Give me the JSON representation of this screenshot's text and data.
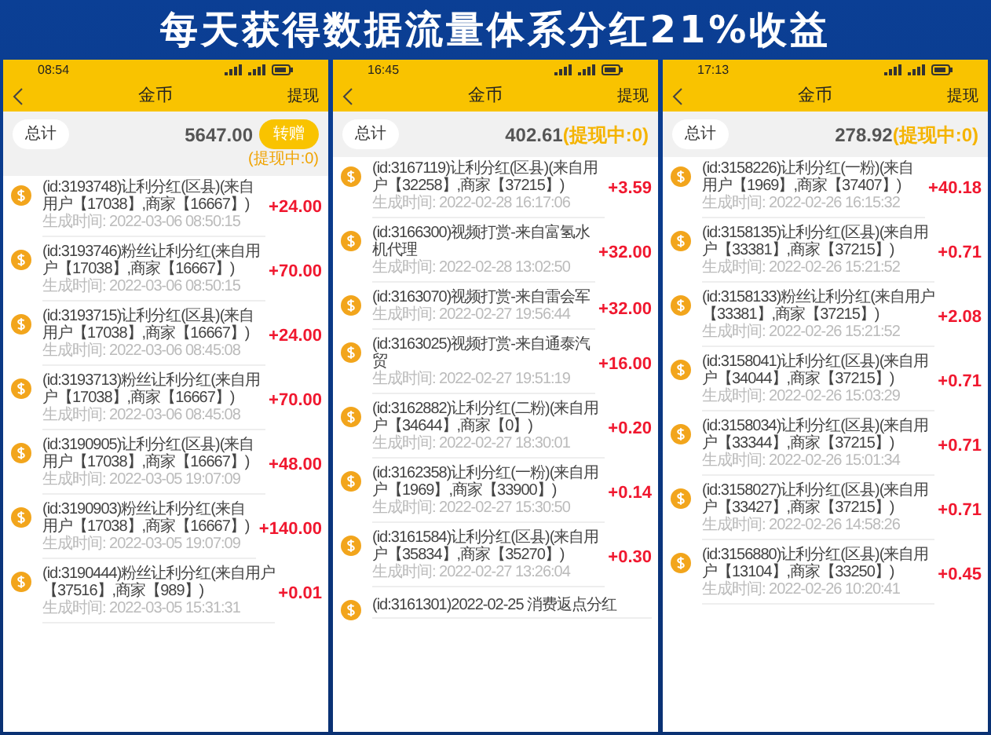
{
  "headline": "每天获得数据流量体系分红21%收益",
  "phones": [
    {
      "kind": "with_transfer",
      "status_time": "08:54",
      "title": "金币",
      "action": "提现",
      "total_label": "总计",
      "total": "5647.00",
      "transfer_button": "转赠",
      "pending": "(提现中:0)",
      "records": [
        {
          "description": "(id:3193748)让利分红(区县)(来自用户【17038】,商家【16667】)",
          "time": "生成时间: 2022-03-06 08:50:15",
          "amount": "+24.00"
        },
        {
          "description": "(id:3193746)粉丝让利分红(来自用户【17038】,商家【16667】)",
          "time": "生成时间: 2022-03-06 08:50:15",
          "amount": "+70.00"
        },
        {
          "description": "(id:3193715)让利分红(区县)(来自用户【17038】,商家【16667】)",
          "time": "生成时间: 2022-03-06 08:45:08",
          "amount": "+24.00"
        },
        {
          "description": "(id:3193713)粉丝让利分红(来自用户【17038】,商家【16667】)",
          "time": "生成时间: 2022-03-06 08:45:08",
          "amount": "+70.00"
        },
        {
          "description": "(id:3190905)让利分红(区县)(来自用户【17038】,商家【16667】)",
          "time": "生成时间: 2022-03-05 19:07:09",
          "amount": "+48.00"
        },
        {
          "description": "(id:3190903)粉丝让利分红(来自用户【17038】,商家【16667】)",
          "time": "生成时间: 2022-03-05 19:07:09",
          "amount": "+140.00"
        },
        {
          "description": "(id:3190444)粉丝让利分红(来自用户【37516】,商家【989】)",
          "time": "生成时间: 2022-03-05 15:31:31",
          "amount": "+0.01"
        }
      ]
    },
    {
      "kind": "plain",
      "status_time": "16:45",
      "title": "金币",
      "action": "提现",
      "total_label": "总计",
      "total": "402.61",
      "pending": "(提现中:0)",
      "records": [
        {
          "description": "(id:3167119)让利分红(区县)(来自用户【32258】,商家【37215】)",
          "time": "生成时间: 2022-02-28 16:17:06",
          "amount": "+3.59"
        },
        {
          "description": "(id:3166300)视频打赏-来自富氢水机代理",
          "time": "生成时间: 2022-02-28 13:02:50",
          "amount": "+32.00"
        },
        {
          "description": "(id:3163070)视频打赏-来自雷会军",
          "time": "生成时间: 2022-02-27 19:56:44",
          "amount": "+32.00"
        },
        {
          "description": "(id:3163025)视频打赏-来自通泰汽贸",
          "time": "生成时间: 2022-02-27 19:51:19",
          "amount": "+16.00"
        },
        {
          "description": "(id:3162882)让利分红(二粉)(来自用户【34644】,商家【0】)",
          "time": "生成时间: 2022-02-27 18:30:01",
          "amount": "+0.20"
        },
        {
          "description": "(id:3162358)让利分红(一粉)(来自用户【1969】,商家【33900】)",
          "time": "生成时间: 2022-02-27 15:30:50",
          "amount": "+0.14"
        },
        {
          "description": "(id:3161584)让利分红(区县)(来自用户【35834】,商家【35270】)",
          "time": "生成时间: 2022-02-27 13:26:04",
          "amount": "+0.30"
        },
        {
          "description": "(id:3161301)2022-02-25 消费返点分红"
        }
      ]
    },
    {
      "kind": "plain",
      "status_time": "17:13",
      "title": "金币",
      "action": "提现",
      "total_label": "总计",
      "total": "278.92",
      "pending": "(提现中:0)",
      "records": [
        {
          "description": "(id:3158226)让利分红(一粉)(来自用户【1969】,商家【37407】)",
          "time": "生成时间: 2022-02-26 16:15:32",
          "amount": "+40.18"
        },
        {
          "description": "(id:3158135)让利分红(区县)(来自用户【33381】,商家【37215】)",
          "time": "生成时间: 2022-02-26 15:21:52",
          "amount": "+0.71"
        },
        {
          "description": "(id:3158133)粉丝让利分红(来自用户【33381】,商家【37215】)",
          "time": "生成时间: 2022-02-26 15:21:52",
          "amount": "+2.08"
        },
        {
          "description": "(id:3158041)让利分红(区县)(来自用户【34044】,商家【37215】)",
          "time": "生成时间: 2022-02-26 15:03:29",
          "amount": "+0.71"
        },
        {
          "description": "(id:3158034)让利分红(区县)(来自用户【33344】,商家【37215】)",
          "time": "生成时间: 2022-02-26 15:01:34",
          "amount": "+0.71"
        },
        {
          "description": "(id:3158027)让利分红(区县)(来自用户【33427】,商家【37215】)",
          "time": "生成时间: 2022-02-26 14:58:26",
          "amount": "+0.71"
        },
        {
          "description": "(id:3156880)让利分红(区县)(来自用户【13104】,商家【33250】)",
          "time": "生成时间: 2022-02-26 10:20:41",
          "amount": "+0.45"
        }
      ]
    }
  ]
}
